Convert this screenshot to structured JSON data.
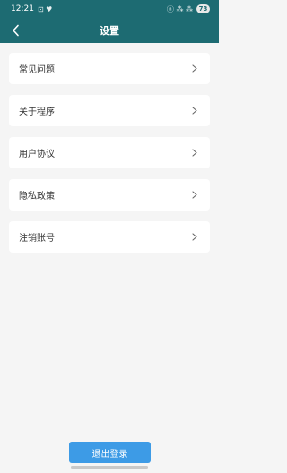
{
  "status_bar": {
    "time": "12:21",
    "left_icons": "⊡ ♥",
    "right_icons": "ⓝ ⁂ ⁂",
    "battery": "73"
  },
  "header": {
    "title": "设置",
    "back_icon": "chevron-left-icon",
    "background": "#1d6b72"
  },
  "menu": {
    "items": [
      {
        "label": "常见问题"
      },
      {
        "label": "关于程序"
      },
      {
        "label": "用户协议"
      },
      {
        "label": "隐私政策"
      },
      {
        "label": "注销账号"
      }
    ]
  },
  "logout": {
    "label": "退出登录",
    "color": "#3d9be6"
  }
}
